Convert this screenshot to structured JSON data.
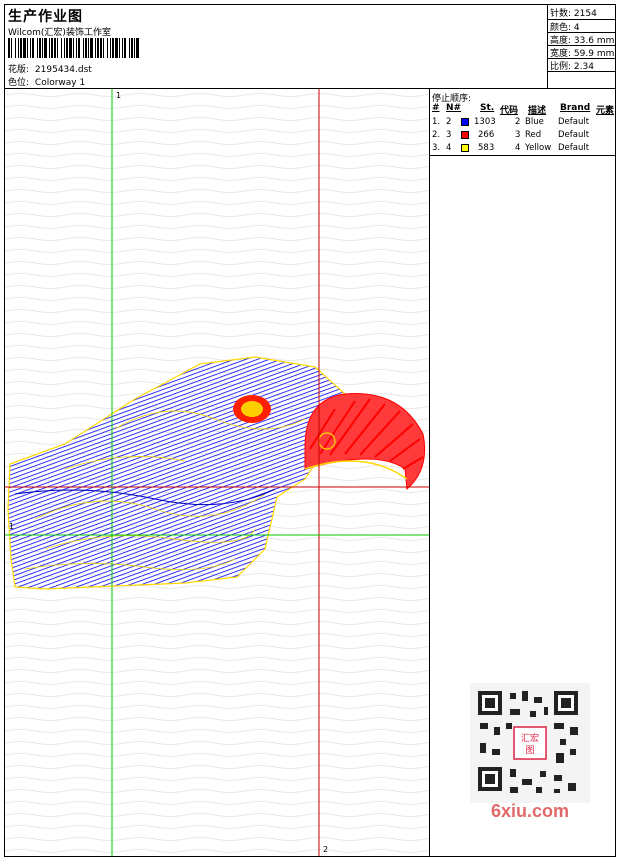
{
  "header": {
    "title": "生产作业图",
    "studio": "Wilcom(汇宏)装饰工作室",
    "design_label": "花版:",
    "design_file": "2195434.dst",
    "colorway_label": "色位:",
    "colorway": "Colorway 1"
  },
  "specs": [
    {
      "label": "针数:",
      "value": "2154"
    },
    {
      "label": "颜色:",
      "value": "4"
    },
    {
      "label": "高度:",
      "value": "33.6 mm"
    },
    {
      "label": "宽度:",
      "value": "59.9 mm"
    },
    {
      "label": "比例:",
      "value": "2.34"
    }
  ],
  "stop_sequence": {
    "title": "停止顺序:",
    "headers": {
      "num": "#",
      "needle": "N#",
      "stitches": "St.",
      "code": "代码",
      "description": "描述",
      "brand": "Brand",
      "element": "元素"
    },
    "rows": [
      {
        "num": "1.",
        "needle": "2",
        "color": "#0000ff",
        "stitches": "1303",
        "code": "2",
        "description": "Blue",
        "brand": "Default"
      },
      {
        "num": "2.",
        "needle": "3",
        "color": "#ff0000",
        "stitches": "266",
        "code": "3",
        "description": "Red",
        "brand": "Default"
      },
      {
        "num": "3.",
        "needle": "4",
        "color": "#ffff00",
        "stitches": "583",
        "code": "4",
        "description": "Yellow",
        "brand": "Default"
      }
    ]
  },
  "guides": {
    "v1": "1",
    "v2": "2",
    "h1": "1"
  },
  "watermark": {
    "text": "6xiu.com",
    "seal": "汇宏图"
  },
  "colors": {
    "blue": "#0000ff",
    "red": "#ff0000",
    "yellow": "#ffff00",
    "guide_green": "#00cc00",
    "guide_red": "#cc0000"
  }
}
